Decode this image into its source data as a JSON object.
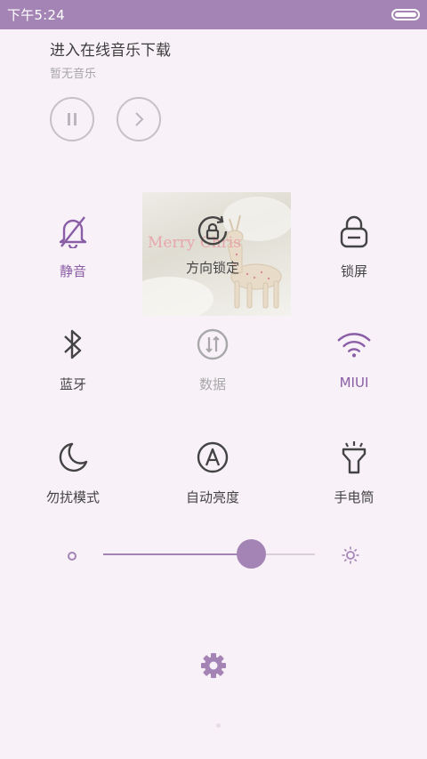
{
  "status_bar": {
    "time": "下午5:24"
  },
  "music": {
    "title": "进入在线音乐下载",
    "subtitle": "暂无音乐",
    "pause_icon": "pause-icon",
    "next_icon": "chevron-right-icon"
  },
  "tiles": [
    {
      "label": "静音",
      "icon": "bell-off-icon",
      "state": "active"
    },
    {
      "label": "方向锁定",
      "icon": "rotation-lock-icon",
      "state": "normal"
    },
    {
      "label": "锁屏",
      "icon": "lock-icon",
      "state": "normal"
    },
    {
      "label": "蓝牙",
      "icon": "bluetooth-icon",
      "state": "normal"
    },
    {
      "label": "数据",
      "icon": "data-icon",
      "state": "disabled"
    },
    {
      "label": "MIUI",
      "icon": "wifi-icon",
      "state": "active"
    },
    {
      "label": "勿扰模式",
      "icon": "moon-icon",
      "state": "normal"
    },
    {
      "label": "自动亮度",
      "icon": "auto-brightness-icon",
      "state": "normal"
    },
    {
      "label": "手电筒",
      "icon": "flashlight-icon",
      "state": "normal"
    }
  ],
  "overlay_image": {
    "text": "Merry Chris"
  },
  "brightness": {
    "level": 0.7
  },
  "colors": {
    "accent": "#a484b5",
    "active_label": "#8a5ea6",
    "background": "#f8f1f8"
  },
  "settings_icon": "gear-icon"
}
